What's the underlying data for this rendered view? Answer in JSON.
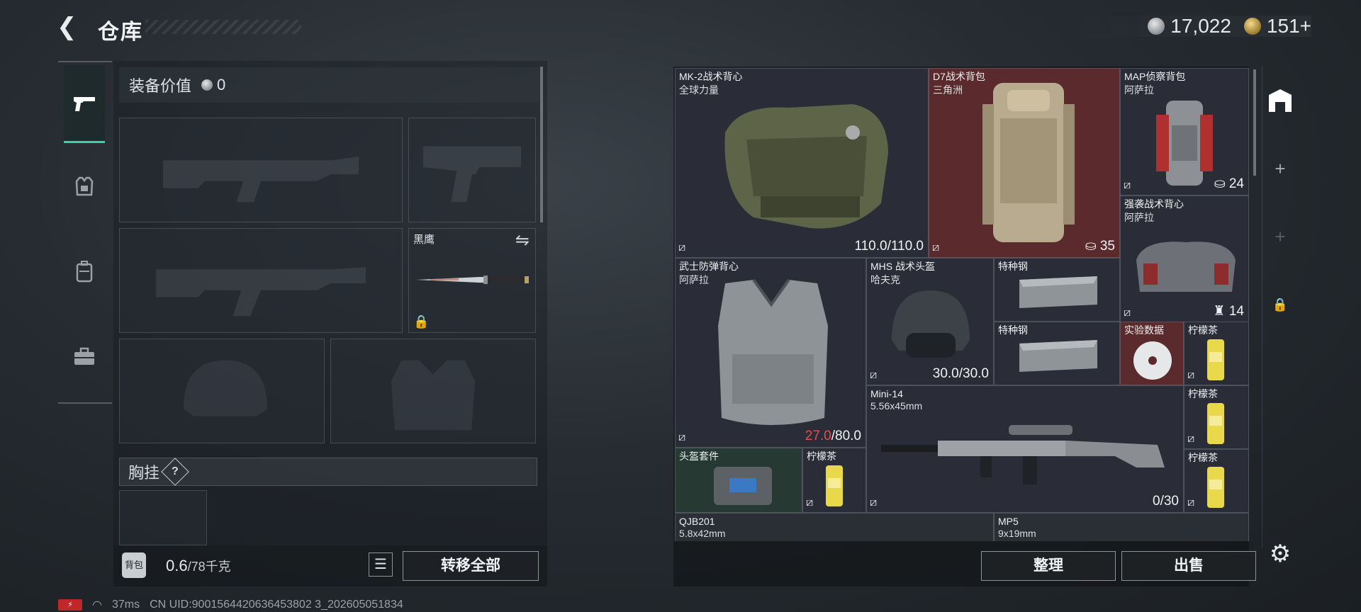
{
  "header": {
    "back_glyph": "❮",
    "title": "仓库",
    "silver_value": "17,022",
    "gold_value": "151",
    "add_glyph": "+"
  },
  "left_rail": [
    {
      "name": "weapons",
      "icon": "pistol-icon",
      "glyph": "⌐",
      "active": true
    },
    {
      "name": "armor",
      "icon": "armor-icon",
      "glyph": "⛨",
      "active": false
    },
    {
      "name": "bags",
      "icon": "backpack-icon",
      "glyph": "▤",
      "active": false
    },
    {
      "name": "kits",
      "icon": "toolbox-icon",
      "glyph": "⊞",
      "active": false
    }
  ],
  "loadout": {
    "value_label": "装备价值",
    "value": "0",
    "melee_name": "黑鹰",
    "swap_glyph": "⇋",
    "lock_glyph": "🔒",
    "chest_label": "胸挂",
    "help_glyph": "?",
    "weight_current": "0.6",
    "weight_max": "/78千克",
    "bag_label": "背包",
    "list_glyph": "☰",
    "transfer_all": "转移全部"
  },
  "storage_items": [
    {
      "id": "mk2",
      "name": "MK-2战术背心",
      "brand": "全球力量",
      "durability": "110.0/110.0"
    },
    {
      "id": "d7",
      "name": "D7战术背包",
      "brand": "三角洲",
      "capacity": "35"
    },
    {
      "id": "map",
      "name": "MAP侦察背包",
      "brand": "阿萨拉",
      "capacity": "24"
    },
    {
      "id": "assault",
      "name": "强袭战术背心",
      "brand": "阿萨拉",
      "capacity": "14"
    },
    {
      "id": "samurai",
      "name": "武士防弹背心",
      "brand": "阿萨拉",
      "durability_current": "27.0",
      "durability_max": "/80.0"
    },
    {
      "id": "mhs",
      "name": "MHS 战术头盔",
      "brand": "哈夫克",
      "durability": "30.0/30.0"
    },
    {
      "id": "steel1",
      "name": "特种钢"
    },
    {
      "id": "steel2",
      "name": "特种钢"
    },
    {
      "id": "data",
      "name": "实验数据"
    },
    {
      "id": "tea1",
      "name": "柠檬茶"
    },
    {
      "id": "tea2",
      "name": "柠檬茶"
    },
    {
      "id": "tea3",
      "name": "柠檬茶"
    },
    {
      "id": "tea4",
      "name": "柠檬茶"
    },
    {
      "id": "mini14",
      "name": "Mini-14",
      "brand": "5.56x45mm",
      "ammo": "0/30"
    },
    {
      "id": "helmkit",
      "name": "头盔套件"
    },
    {
      "id": "qjb",
      "name": "QJB201",
      "brand": "5.8x42mm"
    },
    {
      "id": "mp5",
      "name": "MP5",
      "brand": "9x19mm"
    }
  ],
  "actions": {
    "sort": "整理",
    "sell": "出售",
    "settings_glyph": "⚙"
  },
  "right_rail": {
    "home_glyph": "⌂",
    "plus_glyph": "+",
    "lock_glyph": "🔒"
  },
  "status": {
    "ping": "37ms",
    "uid": "CN UID:9001564420636453802 3_202605051834"
  },
  "colors": {
    "accent": "#3fd0a6",
    "red_slot": "#5a2a2c",
    "green_slot": "#263a33",
    "item_bg": "#2a2d38",
    "damage": "#e05050"
  }
}
